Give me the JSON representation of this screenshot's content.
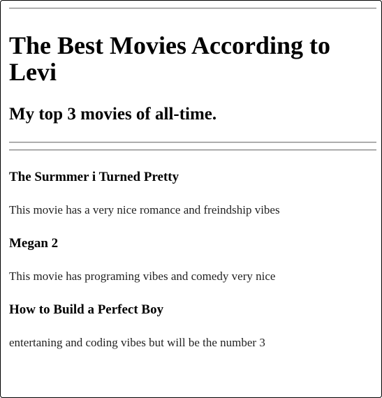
{
  "page": {
    "title": "The Best Movies According to Levi",
    "subtitle": "My top 3 movies of all-time."
  },
  "movies": [
    {
      "title": "The Surmmer i Turned Pretty",
      "description": "This movie has a very nice romance and freindship vibes"
    },
    {
      "title": "Megan 2",
      "description": "This movie has programing vibes and comedy very nice"
    },
    {
      "title": "How to Build a Perfect Boy",
      "description": "entertaning and coding vibes but will be the number 3"
    }
  ]
}
